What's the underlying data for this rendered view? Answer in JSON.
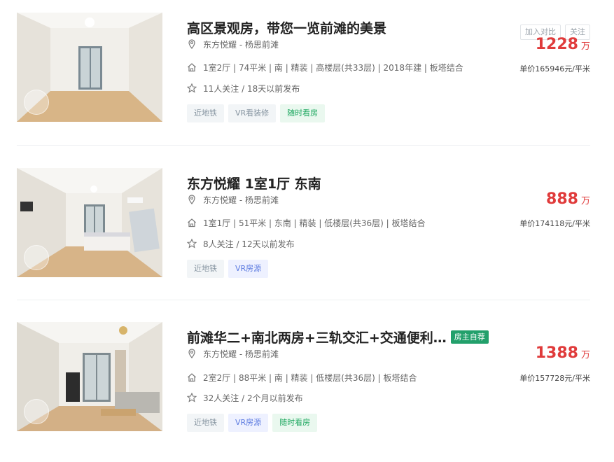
{
  "listings": [
    {
      "title": "高区景观房，带您一览前滩的美景",
      "owner_tag": "",
      "location": "东方悦耀 - 杨思前滩",
      "specs": "1室2厅 | 74平米 | 南 | 精装 | 高楼层(共33层) | 2018年建 | 板塔结合",
      "follow": "11人关注 / 18天以前发布",
      "tags": [
        "近地铁",
        "VR看装修",
        "随时看房"
      ],
      "tag_styles": [
        "gray",
        "gray",
        "green"
      ],
      "compare_label": "加入对比",
      "follow_label": "关注",
      "price": "1228",
      "price_unit": "万",
      "unit_price": "单价165946元/平米"
    },
    {
      "title": "东方悦耀 1室1厅 东南",
      "owner_tag": "",
      "location": "东方悦耀 - 杨思前滩",
      "specs": "1室1厅 | 51平米 | 东南 | 精装 | 低楼层(共36层) | 板塔结合",
      "follow": "8人关注 / 12天以前发布",
      "tags": [
        "近地铁",
        "VR房源"
      ],
      "tag_styles": [
        "gray",
        "blue"
      ],
      "price": "888",
      "price_unit": "万",
      "unit_price": "单价174118元/平米"
    },
    {
      "title": "前滩华二+南北两房+三轨交汇+交通便利…",
      "owner_tag": "房主自荐",
      "location": "东方悦耀 - 杨思前滩",
      "specs": "2室2厅 | 88平米 | 南 | 精装 | 低楼层(共36层) | 板塔结合",
      "follow": "32人关注 / 2个月以前发布",
      "tags": [
        "近地铁",
        "VR房源",
        "随时看房"
      ],
      "tag_styles": [
        "gray",
        "blue",
        "green"
      ],
      "price": "1388",
      "price_unit": "万",
      "unit_price": "单价157728元/平米"
    }
  ],
  "icons": {
    "location": "location-pin-icon",
    "house": "house-icon",
    "star": "star-icon",
    "vr": "vr-badge-icon"
  },
  "colors": {
    "price": "#e03b3b",
    "owner_tag": "#22a06b",
    "tag_blue": "#5c7be0",
    "tag_green": "#1fa860"
  }
}
